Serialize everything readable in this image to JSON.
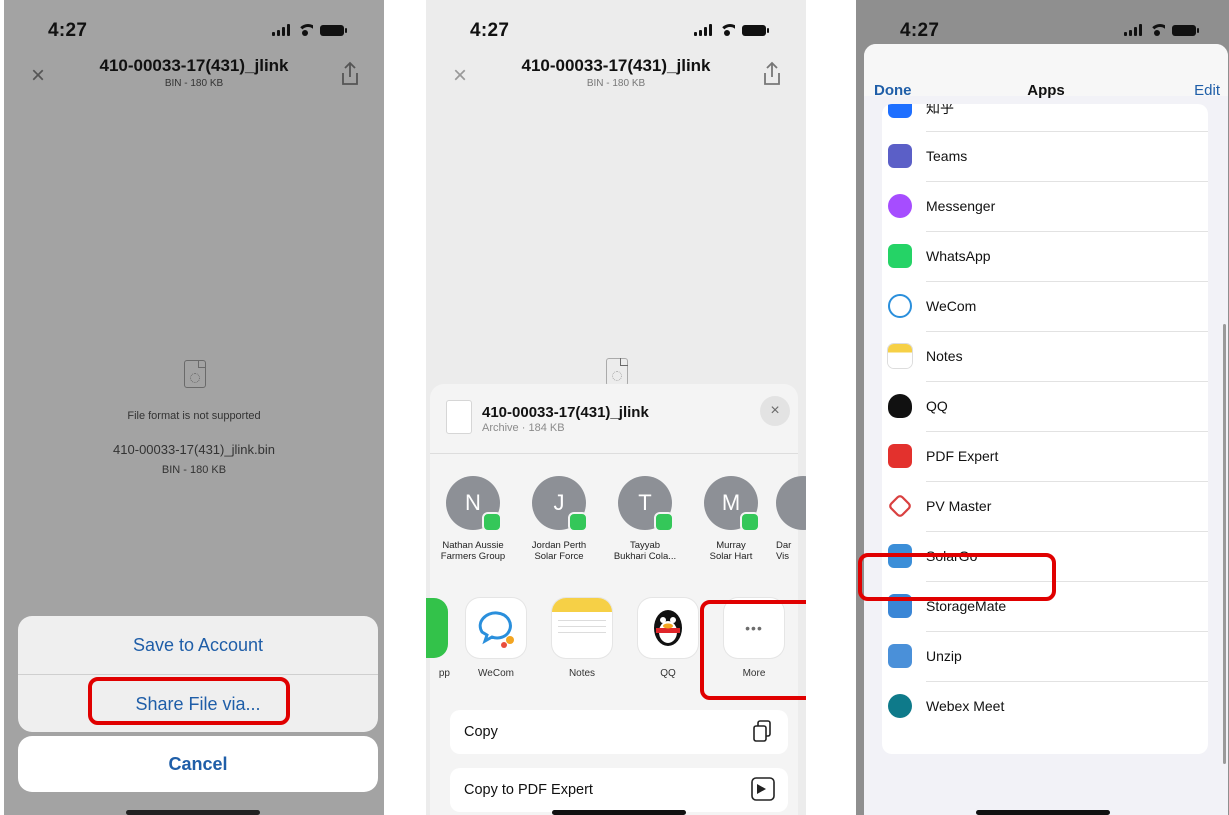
{
  "panel1": {
    "time": "4:27",
    "file_title": "410-00033-17(431)_jlink",
    "file_subtitle": "BIN - 180 KB",
    "unsupported_message": "File format is not supported",
    "file_name": "410-00033-17(431)_jlink.bin",
    "file_size": "BIN - 180 KB",
    "save_label": "Save to Account",
    "share_label": "Share File via...",
    "cancel_label": "Cancel"
  },
  "panel2": {
    "time": "4:27",
    "file_title": "410-00033-17(431)_jlink",
    "file_subtitle": "BIN - 180 KB",
    "sheet_title": "410-00033-17(431)_jlink",
    "sheet_subtitle": "Archive · 184 KB",
    "close_symbol": "×",
    "contacts": [
      {
        "initial": "N",
        "line1": "Nathan Aussie",
        "line2": "Farmers Group"
      },
      {
        "initial": "J",
        "line1": "Jordan Perth",
        "line2": "Solar Force"
      },
      {
        "initial": "T",
        "line1": "Tayyab",
        "line2": "Bukhari Cola..."
      },
      {
        "initial": "M",
        "line1": "Murray",
        "line2": "Solar Hart"
      },
      {
        "initial": "",
        "line1": "Dar",
        "line2": "Vis"
      }
    ],
    "apps": [
      {
        "name": "pp",
        "icon": "whatsapp-icon"
      },
      {
        "name": "WeCom",
        "icon": "wecom-icon"
      },
      {
        "name": "Notes",
        "icon": "notes-icon"
      },
      {
        "name": "QQ",
        "icon": "qq-icon"
      },
      {
        "name": "More",
        "icon": "more-icon"
      }
    ],
    "more_glyph": "•••",
    "options": [
      {
        "label": "Copy",
        "icon": "copy-icon"
      },
      {
        "label": "Copy to PDF Expert",
        "icon": "pdf-expert-icon"
      }
    ]
  },
  "panel3": {
    "time": "4:27",
    "done_label": "Done",
    "title": "Apps",
    "edit_label": "Edit",
    "apps": [
      {
        "label": "知乎",
        "color": "#1e6fff"
      },
      {
        "label": "Teams",
        "color": "#5b5fc7"
      },
      {
        "label": "Messenger",
        "color": "#a64dff"
      },
      {
        "label": "WhatsApp",
        "color": "#25d366"
      },
      {
        "label": "WeCom",
        "color": "#2a8fdc"
      },
      {
        "label": "Notes",
        "color": "#f6d046"
      },
      {
        "label": "QQ",
        "color": "#111111"
      },
      {
        "label": "PDF Expert",
        "color": "#e3312d"
      },
      {
        "label": "PV Master",
        "color": "#d94040"
      },
      {
        "label": "SolarGo",
        "color": "#3b8ed8"
      },
      {
        "label": "StorageMate",
        "color": "#3a86d6"
      },
      {
        "label": "Unzip",
        "color": "#4a90d9"
      },
      {
        "label": "Webex Meet",
        "color": "#0e7a8a"
      }
    ]
  },
  "colors": {
    "accent_blue": "#1f5ea8",
    "highlight_red": "#e00000"
  }
}
